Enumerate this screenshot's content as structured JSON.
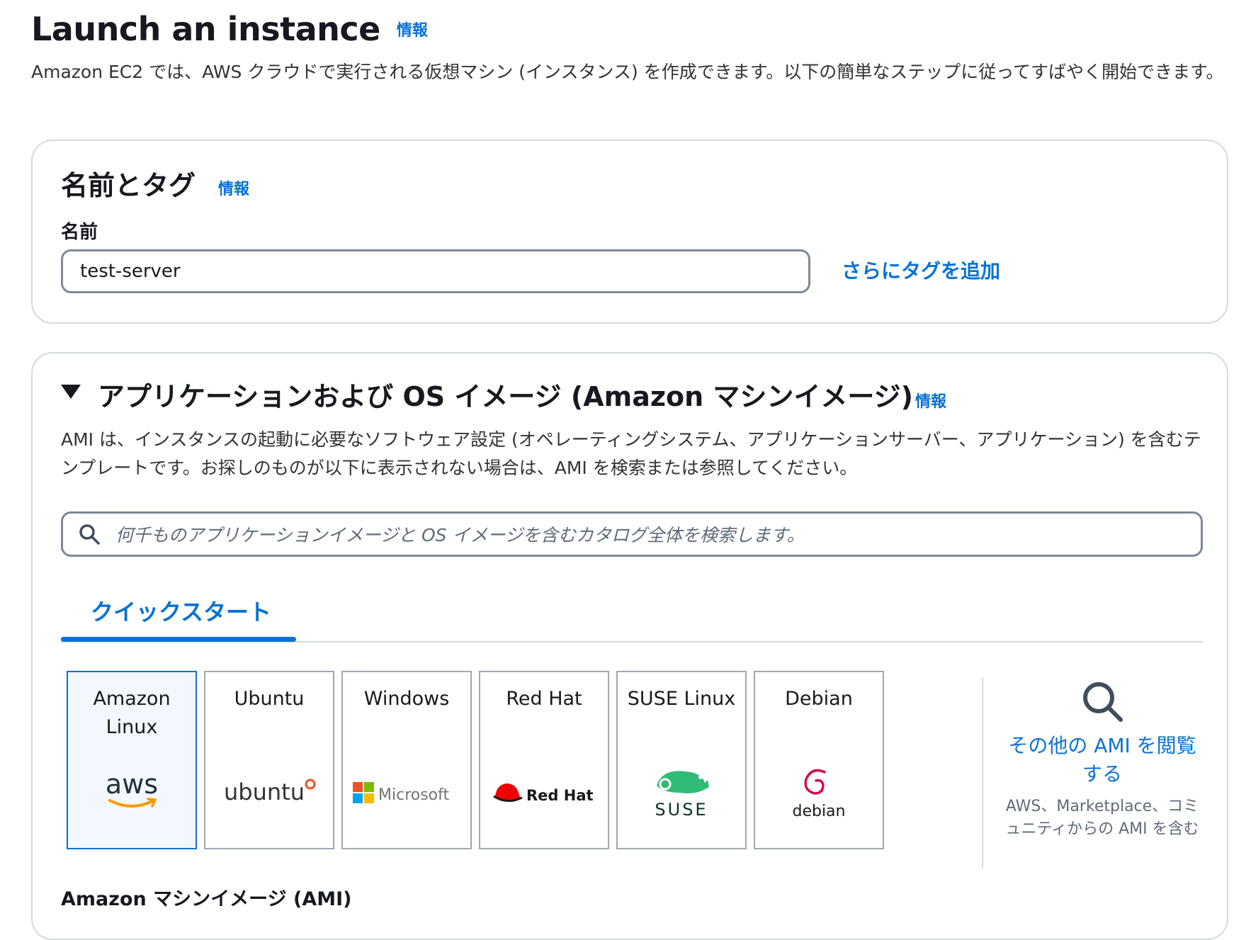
{
  "header": {
    "title": "Launch an instance",
    "info": "情報",
    "description": "Amazon EC2 では、AWS クラウドで実行される仮想マシン (インスタンス) を作成できます。以下の簡単なステップに従ってすばやく開始できます。"
  },
  "name_tags": {
    "title": "名前とタグ",
    "info": "情報",
    "name_label": "名前",
    "name_value": "test-server",
    "add_tags": "さらにタグを追加"
  },
  "ami": {
    "title": "アプリケーションおよび OS イメージ (Amazon マシンイメージ)",
    "info": "情報",
    "description": "AMI は、インスタンスの起動に必要なソフトウェア設定 (オペレーティングシステム、アプリケーションサーバー、アプリケーション) を含むテンプレートです。お探しのものが以下に表示されない場合は、AMI を検索または参照してください。",
    "search_placeholder": "何千ものアプリケーションイメージと OS イメージを含むカタログ全体を検索します。",
    "tab": "クイックスタート",
    "tiles": [
      {
        "label": "Amazon Linux",
        "logo": "aws",
        "selected": true
      },
      {
        "label": "Ubuntu",
        "logo": "ubuntu",
        "selected": false
      },
      {
        "label": "Windows",
        "logo": "Microsoft",
        "selected": false
      },
      {
        "label": "Red Hat",
        "logo": "Red Hat",
        "selected": false
      },
      {
        "label": "SUSE Linux",
        "logo": "SUSE",
        "selected": false
      },
      {
        "label": "Debian",
        "logo": "debian",
        "selected": false
      }
    ],
    "browse_link": "その他の AMI を閲覧する",
    "browse_note": "AWS、Marketplace、コミュニティからの AMI を含む",
    "section_heading": "Amazon マシンイメージ (AMI)"
  },
  "colors": {
    "accent": "#0972d3",
    "border": "#7d8998",
    "panel_border": "#d5dbdb",
    "aws_orange": "#ff9900",
    "ubuntu_orange": "#e95420",
    "redhat_red": "#ee0000",
    "suse_green": "#30ba78",
    "debian_red": "#d70a53"
  }
}
